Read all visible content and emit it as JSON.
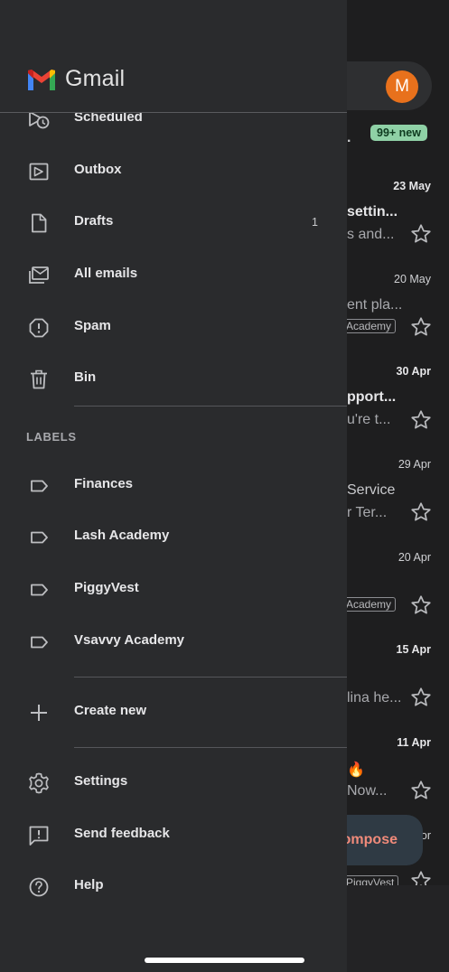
{
  "app": {
    "name": "Gmail"
  },
  "account": {
    "avatar_letter": "M",
    "avatar_color": "#e8711c"
  },
  "inbox": {
    "new_badge": "99+ new",
    "compose_label": "ompose",
    "dot": ".",
    "rows": [
      {
        "date": "23 May",
        "date_bold": true,
        "subject": "settin...",
        "snippet": "s and...",
        "tag": ""
      },
      {
        "date": "20 May",
        "date_bold": false,
        "subject": "",
        "snippet": "ent pla...",
        "tag": "Academy"
      },
      {
        "date": "30 Apr",
        "date_bold": true,
        "subject": "pport...",
        "snippet": "u're t...",
        "tag": ""
      },
      {
        "date": "29 Apr",
        "date_bold": false,
        "subject": "",
        "snippet": "Service",
        "snippet2": "r Ter...",
        "tag": ""
      },
      {
        "date": "20 Apr",
        "date_bold": false,
        "subject": "",
        "snippet": "",
        "tag": "Academy"
      },
      {
        "date": "15 Apr",
        "date_bold": true,
        "subject": "",
        "snippet": "lina he...",
        "tag": ""
      },
      {
        "date": "11 Apr",
        "date_bold": true,
        "subject": "🔥",
        "snippet": "Now...",
        "tag": ""
      },
      {
        "date": "or",
        "date_bold": false,
        "subject": "",
        "snippet": "",
        "tag": "PiggyVest"
      }
    ]
  },
  "drawer": {
    "items": [
      {
        "label": "Scheduled",
        "icon": "scheduled-icon",
        "count": ""
      },
      {
        "label": "Outbox",
        "icon": "outbox-icon",
        "count": ""
      },
      {
        "label": "Drafts",
        "icon": "drafts-icon",
        "count": "1"
      },
      {
        "label": "All emails",
        "icon": "all-mail-icon",
        "count": ""
      },
      {
        "label": "Spam",
        "icon": "spam-icon",
        "count": ""
      },
      {
        "label": "Bin",
        "icon": "bin-icon",
        "count": ""
      }
    ],
    "labels_heading": "LABELS",
    "labels": [
      {
        "label": "Finances",
        "icon": "label-icon"
      },
      {
        "label": "Lash Academy",
        "icon": "label-icon"
      },
      {
        "label": "PiggyVest",
        "icon": "label-icon"
      },
      {
        "label": "Vsavvy Academy",
        "icon": "label-icon"
      }
    ],
    "create_new": "Create new",
    "footer": [
      {
        "label": "Settings",
        "icon": "settings-icon"
      },
      {
        "label": "Send feedback",
        "icon": "feedback-icon"
      },
      {
        "label": "Help",
        "icon": "help-icon"
      }
    ]
  }
}
